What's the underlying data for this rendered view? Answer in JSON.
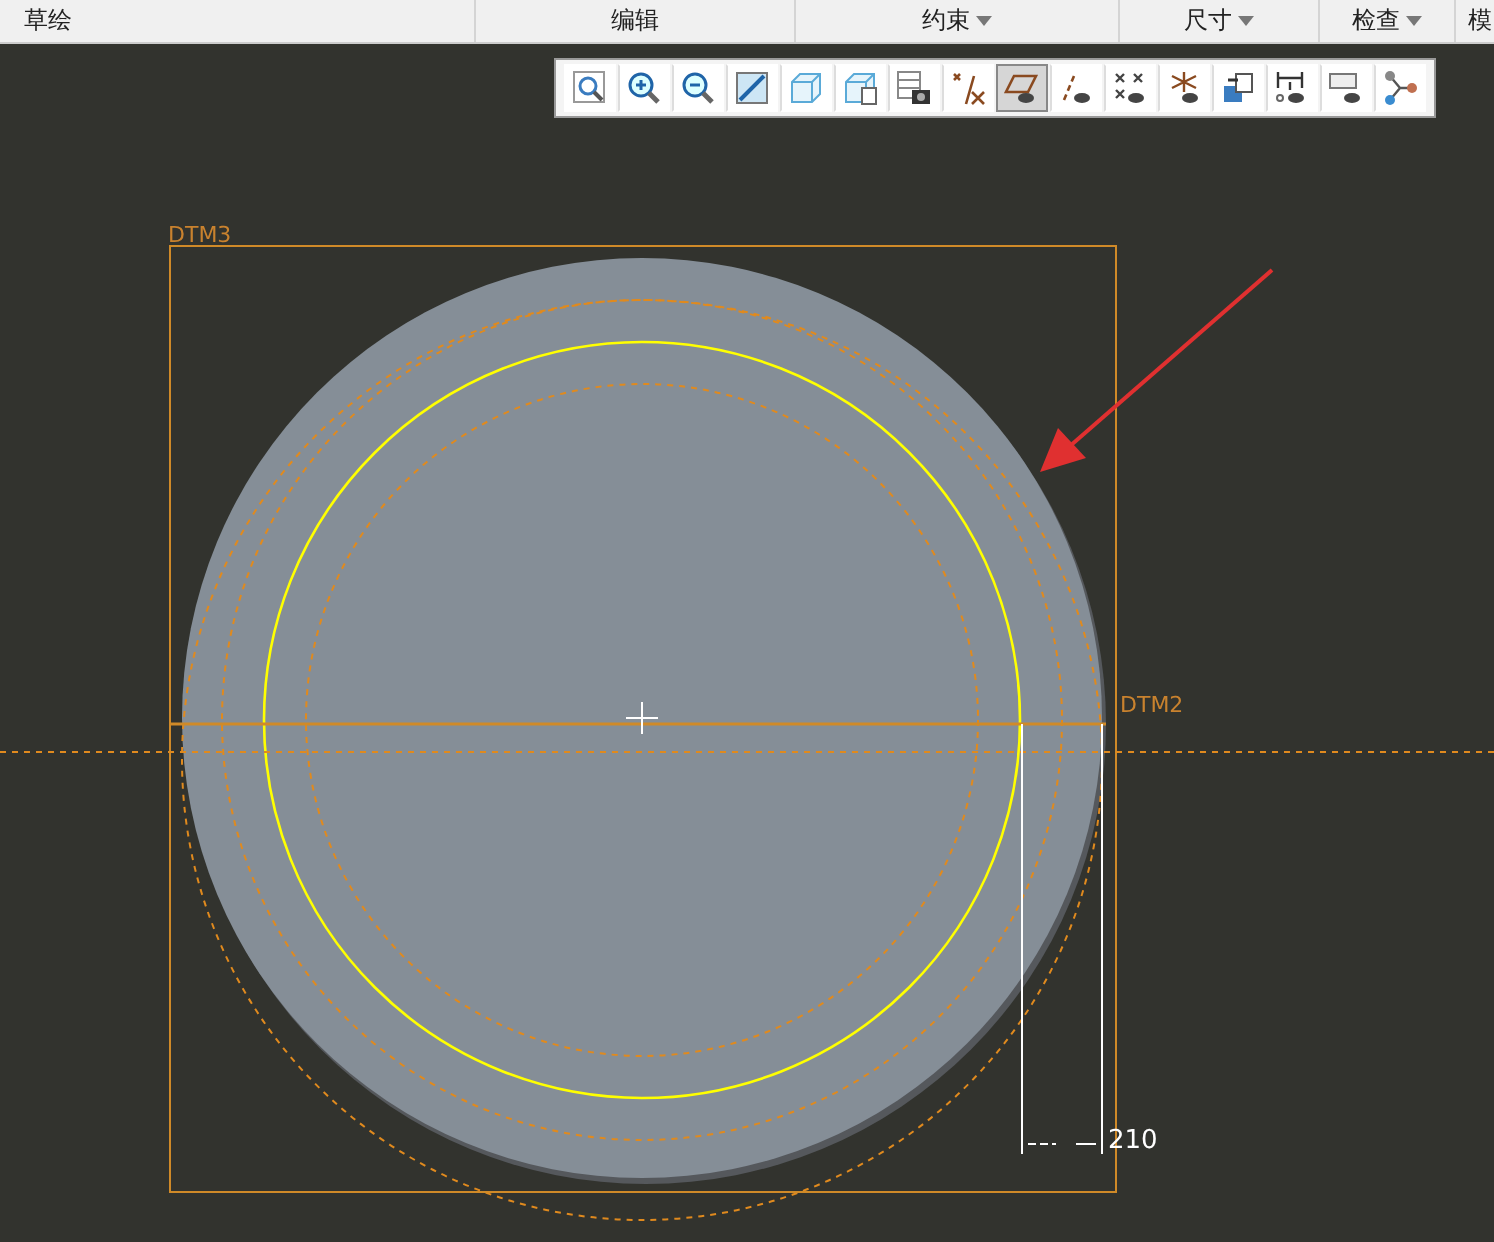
{
  "ribbon": {
    "groups": [
      {
        "label": "草绘",
        "has_menu": false
      },
      {
        "label": "编辑",
        "has_menu": false
      },
      {
        "label": "约束",
        "has_menu": true
      },
      {
        "label": "尺寸",
        "has_menu": true
      },
      {
        "label": "检查",
        "has_menu": true
      },
      {
        "label": "模",
        "has_menu": false
      }
    ]
  },
  "toolbar": {
    "buttons": [
      {
        "kind": "zoom-fit",
        "selected": false
      },
      {
        "kind": "zoom-in",
        "selected": false
      },
      {
        "kind": "zoom-out",
        "selected": false
      },
      {
        "kind": "repaint",
        "selected": false
      },
      {
        "kind": "cube",
        "selected": false
      },
      {
        "kind": "cube-list",
        "selected": false
      },
      {
        "kind": "table-camera",
        "selected": false
      },
      {
        "kind": "cross-marks",
        "selected": false
      },
      {
        "kind": "plane-eye",
        "selected": true
      },
      {
        "kind": "slash-eye",
        "selected": false
      },
      {
        "kind": "xx-eye",
        "selected": false
      },
      {
        "kind": "axes-eye",
        "selected": false
      },
      {
        "kind": "copy-arrow",
        "selected": false
      },
      {
        "kind": "dimension-eye",
        "selected": false
      },
      {
        "kind": "box-eye",
        "selected": false
      },
      {
        "kind": "nodes",
        "selected": false
      }
    ]
  },
  "canvas": {
    "datum_labels": [
      "DTM3",
      "DTM2"
    ],
    "dimension": "210"
  }
}
